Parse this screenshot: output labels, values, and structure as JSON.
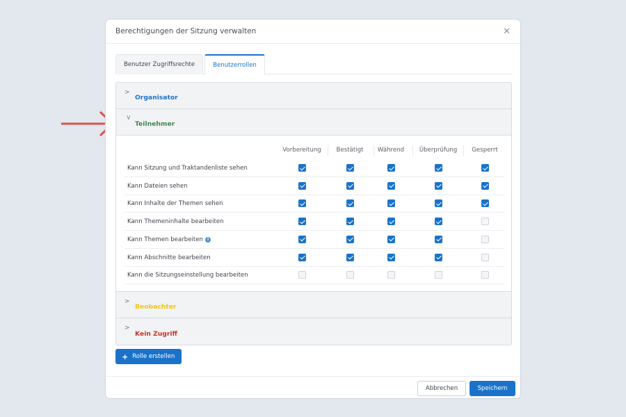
{
  "modal": {
    "title": "Berechtigungen der Sitzung verwalten",
    "close_icon": "close-icon"
  },
  "tabs": [
    {
      "label": "Benutzer Zugriffsrechte",
      "active": false
    },
    {
      "label": "Benutzerrollen",
      "active": true
    }
  ],
  "roles": [
    {
      "label": "Organisator",
      "color": "#1a73c9",
      "expanded": false
    },
    {
      "label": "Teilnehmer",
      "color": "#3f8a4d",
      "expanded": true
    },
    {
      "label": "Beobachter",
      "color": "#f2c417",
      "expanded": false
    },
    {
      "label": "Kein Zugriff",
      "color": "#c0392b",
      "expanded": false
    }
  ],
  "permissions": {
    "columns": [
      "Vorbereitung",
      "Bestätigt",
      "Während",
      "Überprüfung",
      "Gesperrt"
    ],
    "rows": [
      {
        "label": "Kann Sitzung und Traktandenliste sehen",
        "info": false,
        "values": [
          true,
          true,
          true,
          true,
          true
        ]
      },
      {
        "label": "Kann Dateien sehen",
        "info": false,
        "values": [
          true,
          true,
          true,
          true,
          true
        ]
      },
      {
        "label": "Kann Inhalte der Themen sehen",
        "info": false,
        "values": [
          true,
          true,
          true,
          true,
          true
        ]
      },
      {
        "label": "Kann Themeninhalte bearbeiten",
        "info": false,
        "values": [
          true,
          true,
          true,
          true,
          false
        ]
      },
      {
        "label": "Kann Themen bearbeiten",
        "info": true,
        "values": [
          true,
          true,
          true,
          true,
          false
        ]
      },
      {
        "label": "Kann Abschnitte bearbeiten",
        "info": false,
        "values": [
          true,
          true,
          true,
          true,
          false
        ]
      },
      {
        "label": "Kann die Sitzungseinstellung bearbeiten",
        "info": false,
        "values": [
          false,
          false,
          false,
          false,
          false
        ]
      }
    ]
  },
  "info_icon_glyph": "i",
  "add_role": {
    "plus": "+",
    "label": "Rolle erstellen"
  },
  "footer": {
    "cancel_label": "Abbrechen",
    "save_label": "Speichern"
  },
  "colors": {
    "accent": "#1a73c9",
    "arrow": "#d9534f"
  }
}
